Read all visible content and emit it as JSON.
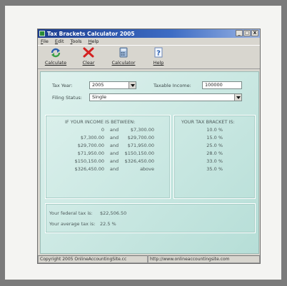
{
  "window": {
    "title": "Tax Brackets Calculator 2005",
    "controls": [
      "_",
      "□",
      "X"
    ]
  },
  "menu": [
    "File",
    "Edit",
    "Tools",
    "Help"
  ],
  "toolbar": [
    {
      "label": "Calculate",
      "icon": "refresh-icon"
    },
    {
      "label": "Clear",
      "icon": "x-icon"
    },
    {
      "label": "Calculator",
      "icon": "calculator-icon"
    },
    {
      "label": "Help",
      "icon": "help-icon"
    }
  ],
  "form": {
    "tax_year_label": "Tax Year:",
    "tax_year_value": "2005",
    "taxable_income_label": "Taxable Income:",
    "taxable_income_value": "100000",
    "filing_status_label": "Filing Status:",
    "filing_status_value": "Single"
  },
  "brackets": {
    "heading_income": "IF YOUR INCOME IS BETWEEN:",
    "heading_rate": "YOUR TAX BRACKET IS:",
    "rows": [
      {
        "low": "0",
        "and": "and",
        "high": "$7,300.00",
        "rate": "10.0  %"
      },
      {
        "low": "$7,300.00",
        "and": "and",
        "high": "$29,700.00",
        "rate": "15.0  %"
      },
      {
        "low": "$29,700.00",
        "and": "and",
        "high": "$71,950.00",
        "rate": "25.0  %"
      },
      {
        "low": "$71,950.00",
        "and": "and",
        "high": "$150,150.00",
        "rate": "28.0  %"
      },
      {
        "low": "$150,150.00",
        "and": "and",
        "high": "$326,450.00",
        "rate": "33.0  %"
      },
      {
        "low": "$326,450.00",
        "and": "and",
        "high": "above",
        "rate": "35.0  %"
      }
    ]
  },
  "results": {
    "federal_label": "Your federal tax is:",
    "federal_value": "$22,506.50",
    "average_label": "Your average tax is:",
    "average_value": "22.5 %"
  },
  "status": {
    "copyright": "Copyright 2005 OnlineAccountingSite.cc",
    "url": "http://www.onlineaccountingsite.com"
  },
  "colors": {
    "title_bar": "#1c3d8f",
    "panel_bg": "#c9e8e2",
    "clear_icon": "#d42020",
    "calculate_icon": "#2a5fb0"
  }
}
